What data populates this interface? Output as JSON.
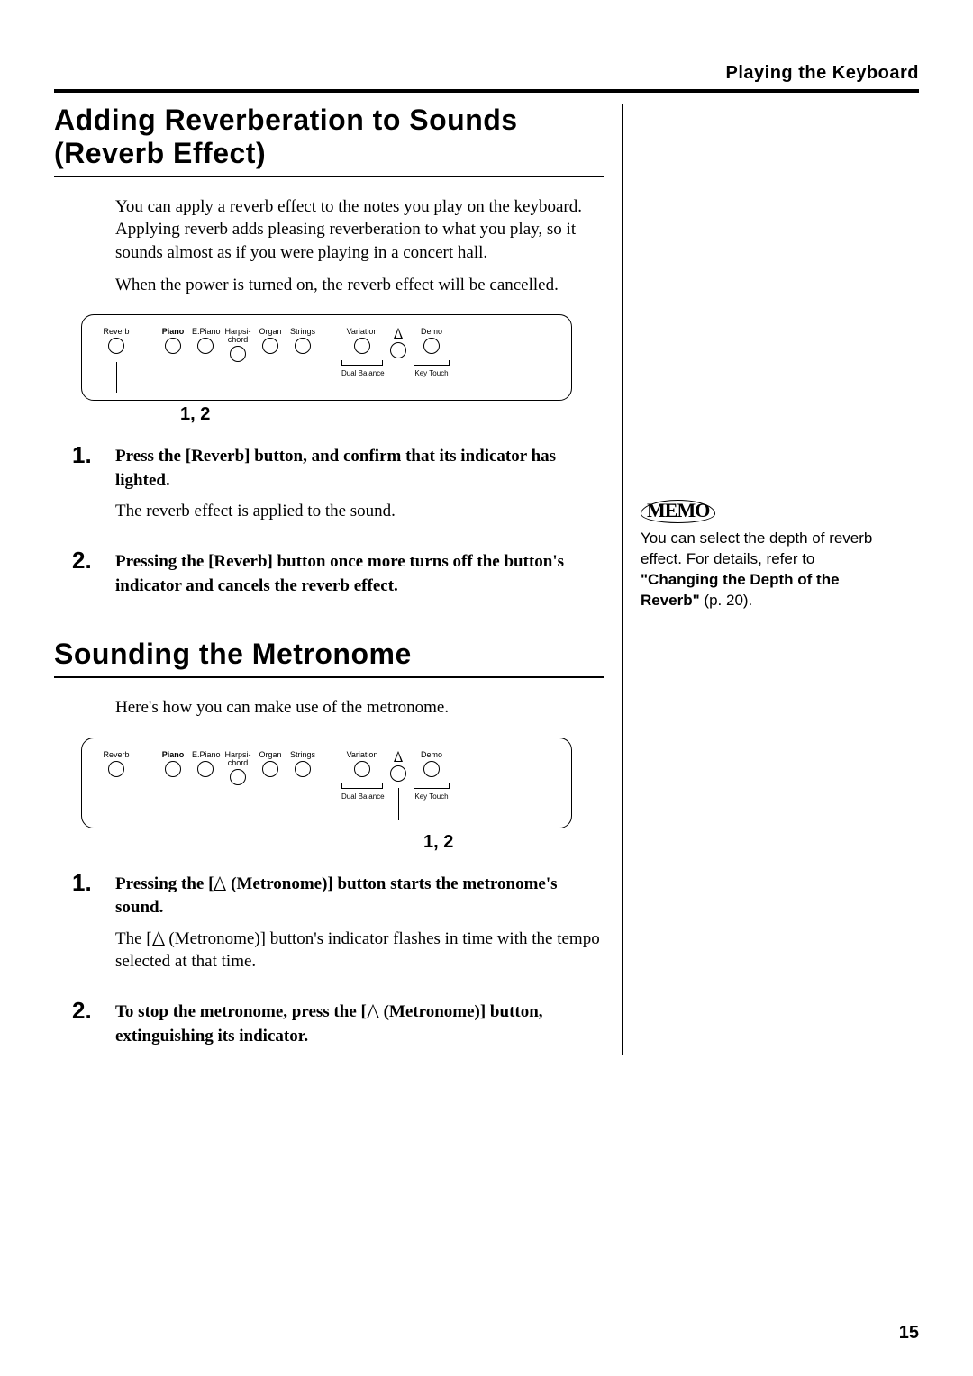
{
  "running_head": "Playing the Keyboard",
  "page_number": "15",
  "panel": {
    "reverb": "Reverb",
    "piano": "Piano",
    "epiano": "E.Piano",
    "harpsi1": "Harpsi-",
    "harpsi2": "chord",
    "organ": "Organ",
    "strings": "Strings",
    "variation": "Variation",
    "demo": "Demo",
    "dual_balance": "Dual Balance",
    "key_touch": "Key Touch"
  },
  "section_a": {
    "title": "Adding Reverberation to Sounds (Reverb Effect)",
    "para1": "You can apply a reverb effect to the notes you play on the keyboard. Applying reverb adds pleasing reverberation to what you play, so it sounds almost as if you were playing in a concert hall.",
    "para2": "When the power is turned on, the reverb effect will be cancelled.",
    "callout": "1, 2",
    "step1_lead": "Press the [Reverb] button, and confirm that its indicator has lighted.",
    "step1_sub": "The reverb effect is applied to the sound.",
    "step2_lead": "Pressing the [Reverb] button once more turns off the button's indicator and cancels the reverb effect."
  },
  "memo": {
    "label": "MEMO",
    "text_a": "You can select the depth of reverb effect. For details, refer to ",
    "text_b": "\"Changing the Depth of the Reverb\"",
    "text_c": " (p. 20)."
  },
  "section_b": {
    "title": "Sounding the Metronome",
    "para1": "Here's how you can make use of the metronome.",
    "callout": "1, 2",
    "step1_lead_a": "Pressing the [",
    "step1_lead_b": " (Metronome)] button starts the metronome's sound.",
    "step1_sub_a": "The [",
    "step1_sub_b": " (Metronome)] button's indicator flashes in time with the tempo selected at that time.",
    "step2_lead_a": "To stop the metronome, press the [",
    "step2_lead_b": "  (Metronome)] button, extinguishing its indicator."
  }
}
